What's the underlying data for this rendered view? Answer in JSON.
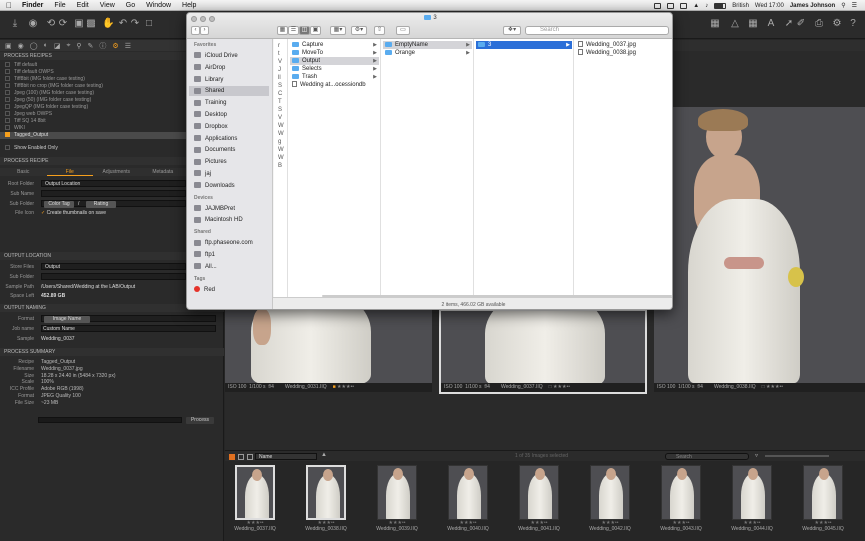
{
  "menubar": {
    "app": "Finder",
    "items": [
      "File",
      "Edit",
      "View",
      "Go",
      "Window",
      "Help"
    ],
    "right": {
      "language": "British",
      "clock": "Wed 17:00",
      "user": "James Johnson"
    }
  },
  "left": {
    "process_recipes_header": "PROCESS RECIPES",
    "recipes": [
      "Tiff default",
      "Tiff default OWPS",
      "Tiff8bit (IMG folder case testing)",
      "Tiff8bit no crop (IMG folder case testing)",
      "Jpeg (100) (IMG folder case testing)",
      "Jpeg (50) (IMG folder case testing)",
      "JpegQP (IMG folder case testing)",
      "Jpeg web OWPS",
      "Tiff SQ 14 8bit",
      "WIKI",
      "Tagged_Output"
    ],
    "show_enabled_only": "Show Enabled Only",
    "process_recipe_header": "PROCESS RECIPE",
    "tabs": [
      "Basic",
      "File",
      "Adjustments",
      "Metadata"
    ],
    "root_folder_label": "Root Folder",
    "root_folder_value": "Output Location",
    "sub_name_label": "Sub Name",
    "sub_folder_label": "Sub Folder",
    "sub_folder_tokens": [
      "Color Tag",
      "/",
      "Rating"
    ],
    "file_icon_label": "File Icon",
    "file_icon_value": "Create thumbnails on save",
    "output_location_header": "OUTPUT LOCATION",
    "store_files_label": "Store Files",
    "store_files_value": "Output",
    "sub_folder2_label": "Sub Folder",
    "sample_path_label": "Sample Path",
    "sample_path_value": "/Users/Shared/Wedding at the LAB/Output",
    "space_left_label": "Space Left",
    "space_left_value": "452.89 GB",
    "output_naming_header": "OUTPUT NAMING",
    "format_label": "Format",
    "format_value": "Image Name",
    "job_name_label": "Job name",
    "job_name_value": "Custom Name",
    "sample_label": "Sample",
    "sample_value": "Wedding_0037",
    "summary_header": "PROCESS SUMMARY",
    "summary": [
      {
        "k": "Recipe",
        "v": "Tagged_Output"
      },
      {
        "k": "Filename",
        "v": "Wedding_0037.jpg"
      },
      {
        "k": "Size",
        "v": "18.28 x 24.40 in (5484 x 7320 px)"
      },
      {
        "k": "Scale",
        "v": "100%"
      },
      {
        "k": "ICC Profile",
        "v": "Adobe RGB (1998)"
      },
      {
        "k": "Format",
        "v": "JPEG Quality 100"
      },
      {
        "k": "File Size",
        "v": "~23 MB"
      }
    ],
    "process_button": "Process"
  },
  "finder": {
    "title": "3",
    "search_placeholder": "Search",
    "sidebar": {
      "favorites_header": "Favorites",
      "favorites": [
        "iCloud Drive",
        "AirDrop",
        "Library",
        "Shared",
        "Training",
        "Desktop",
        "Dropbox",
        "Applications",
        "Documents",
        "Pictures",
        "jaj",
        "Downloads"
      ],
      "devices_header": "Devices",
      "devices": [
        "JAJMBPret",
        "Macintosh HD"
      ],
      "shared_header": "Shared",
      "shared": [
        "ftp.phaseone.com",
        "ftp1",
        "All..."
      ],
      "tags_header": "Tags",
      "tags": [
        "Red"
      ]
    },
    "col0_letters": [
      "r",
      "t",
      "V",
      "J",
      "ll",
      "S",
      "C",
      "T",
      "S",
      "V",
      "W",
      "W",
      "g",
      "W",
      "W",
      "B"
    ],
    "col1": [
      "Capture",
      "MoveTo",
      "Output",
      "Selects",
      "Trash",
      "Wedding at...ocessiondb"
    ],
    "col2": [
      "EmptyName",
      "Orange"
    ],
    "col3": [
      "3"
    ],
    "col4": [
      "Wedding_0037.jpg",
      "Wedding_0038.jpg"
    ],
    "status": "2 items, 466.02 GB available"
  },
  "viewer": {
    "captions": [
      {
        "iso": "ISO 100",
        "shutter": "1/100 s",
        "aperture": "f/4",
        "name": "Wedding_0031.IIQ"
      },
      {
        "iso": "ISO 100",
        "shutter": "1/100 s",
        "aperture": "f/4",
        "name": "Wedding_0037.IIQ"
      },
      {
        "iso": "ISO 100",
        "shutter": "1/100 s",
        "aperture": "f/4",
        "name": "Wedding_0038.IIQ"
      }
    ]
  },
  "browser": {
    "sort": "Name",
    "count": "1 of 35 Images selected",
    "search_placeholder": "Search"
  },
  "filmstrip": [
    "Wedding_0037.IIQ",
    "Wedding_0038.IIQ",
    "Wedding_0039.IIQ",
    "Wedding_0040.IIQ",
    "Wedding_0041.IIQ",
    "Wedding_0042.IIQ",
    "Wedding_0043.IIQ",
    "Wedding_0044.IIQ",
    "Wedding_0045.IIQ"
  ],
  "colors": {
    "accent": "#f7a01d",
    "selection": "#2b6fd8"
  }
}
